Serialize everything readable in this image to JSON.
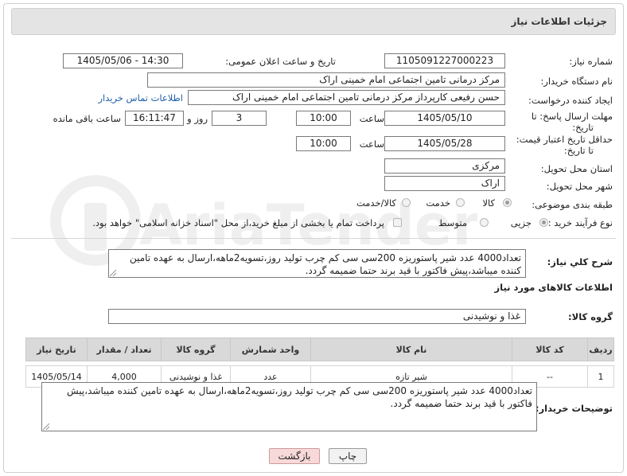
{
  "header": {
    "title": "جزئیات اطلاعات نیاز"
  },
  "fields": {
    "need_number": {
      "label": "شماره نیاز:",
      "value": "1105091227000223"
    },
    "announce_datetime": {
      "label": "تاریخ و ساعت اعلان عمومی:",
      "value": "1405/05/06 - 14:30"
    },
    "buyer_org": {
      "label": "نام دستگاه خریدار:",
      "value": "مرکز درمانی تامین اجتماعی امام خمینی اراک"
    },
    "requester": {
      "label": "ایجاد کننده درخواست:",
      "value": "حسن رفیعی کارپرداز مرکز درمانی تامین اجتماعی امام خمینی اراک",
      "contact_link": "اطلاعات تماس خریدار"
    },
    "reply_deadline": {
      "label_line1": "مهلت ارسال پاسخ: تا",
      "label_line2": "تاریخ:",
      "date": "1405/05/10",
      "time_label": "ساعت",
      "time": "10:00",
      "days": "3",
      "days_label": "روز و",
      "remaining": "16:11:47",
      "remaining_label": "ساعت باقی مانده"
    },
    "price_validity": {
      "label_line1": "حداقل تاریخ اعتبار قیمت:",
      "label_line2": "تا تاریخ:",
      "date": "1405/05/28",
      "time_label": "ساعت",
      "time": "10:00"
    },
    "delivery_province": {
      "label": "استان محل تحویل:",
      "value": "مرکزی"
    },
    "delivery_city": {
      "label": "شهر محل تحویل:",
      "value": "اراک"
    },
    "category": {
      "label": "طبقه بندی موضوعی:",
      "options": [
        "کالا",
        "خدمت",
        "کالا/خدمت"
      ],
      "selected": "کالا"
    },
    "purchase_type": {
      "label": "نوع فرآیند خرید :",
      "options": [
        "جزیی",
        "متوسط"
      ],
      "selected": "جزیی",
      "payment_note": "پرداخت تمام یا بخشی از مبلغ خرید،از محل \"اسناد خزانه اسلامی\" خواهد بود."
    }
  },
  "description": {
    "label": "شرح کلي نياز:",
    "text": "تعداد4000 عدد شیر پاستوریزه 200سی سی کم چرب تولید روز،تسویه2ماهه،ارسال به عهده تامین کننده میباشد،پیش فاکتور با قید برند حتما ضمیمه گردد."
  },
  "goods_section": {
    "title": "اطلاعات کالاهای مورد نیاز",
    "group_label": "گروه کالا:",
    "group_value": "غذا و نوشیدنی"
  },
  "table": {
    "headers": [
      "ردیف",
      "کد کالا",
      "نام کالا",
      "واحد شمارش",
      "گروه کالا",
      "تعداد / مقدار",
      "تاریخ نیاز"
    ],
    "rows": [
      [
        "1",
        "--",
        "شیر تازه",
        "عدد",
        "غذا و نوشیدنی",
        "4,000",
        "1405/05/14"
      ]
    ]
  },
  "buyer_notes": {
    "label": "توضیحات خریدار:",
    "text": "تعداد4000 عدد شیر پاستوریزه 200سی سی کم چرب تولید روز،تسویه2ماهه،ارسال به عهده تامین کننده میباشد،پیش فاکتور با قید برند حتما ضمیمه گردد."
  },
  "buttons": {
    "print": "چاپ",
    "back": "بازگشت"
  },
  "watermark": {
    "text": "AriaTender.net"
  }
}
